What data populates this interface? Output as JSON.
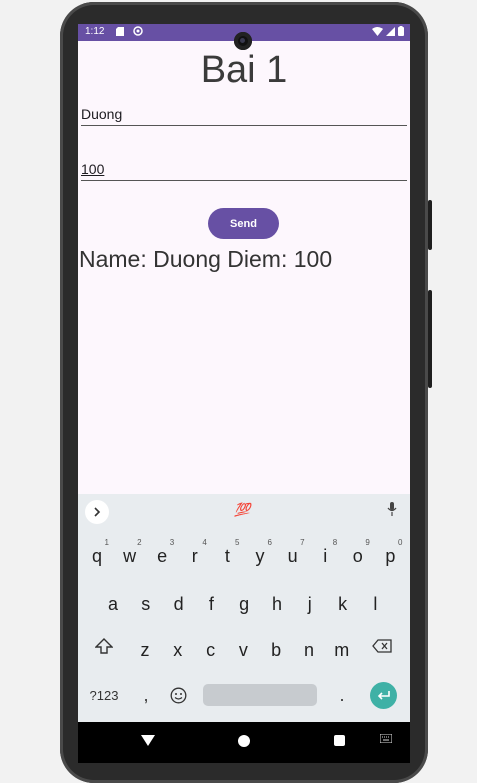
{
  "status": {
    "time": "1:12",
    "icons_left": [
      "sd-card-icon",
      "sync-icon"
    ],
    "icons_right": [
      "wifi-icon",
      "signal-icon",
      "battery-icon"
    ]
  },
  "app": {
    "title": "Bai 1",
    "name_value": "Duong",
    "score_value": "100",
    "send_label": "Send",
    "result_text": "Name: Duong Diem: 100",
    "accent_color": "#6750a4"
  },
  "keyboard": {
    "suggestion": "💯",
    "row1": [
      {
        "key": "q",
        "hint": "1"
      },
      {
        "key": "w",
        "hint": "2"
      },
      {
        "key": "e",
        "hint": "3"
      },
      {
        "key": "r",
        "hint": "4"
      },
      {
        "key": "t",
        "hint": "5"
      },
      {
        "key": "y",
        "hint": "6"
      },
      {
        "key": "u",
        "hint": "7"
      },
      {
        "key": "i",
        "hint": "8"
      },
      {
        "key": "o",
        "hint": "9"
      },
      {
        "key": "p",
        "hint": "0"
      }
    ],
    "row2": [
      "a",
      "s",
      "d",
      "f",
      "g",
      "h",
      "j",
      "k",
      "l"
    ],
    "row3": [
      "z",
      "x",
      "c",
      "v",
      "b",
      "n",
      "m"
    ],
    "symbols_label": "?123",
    "comma": ",",
    "period": ".",
    "enter_color": "#3fb1a6"
  }
}
